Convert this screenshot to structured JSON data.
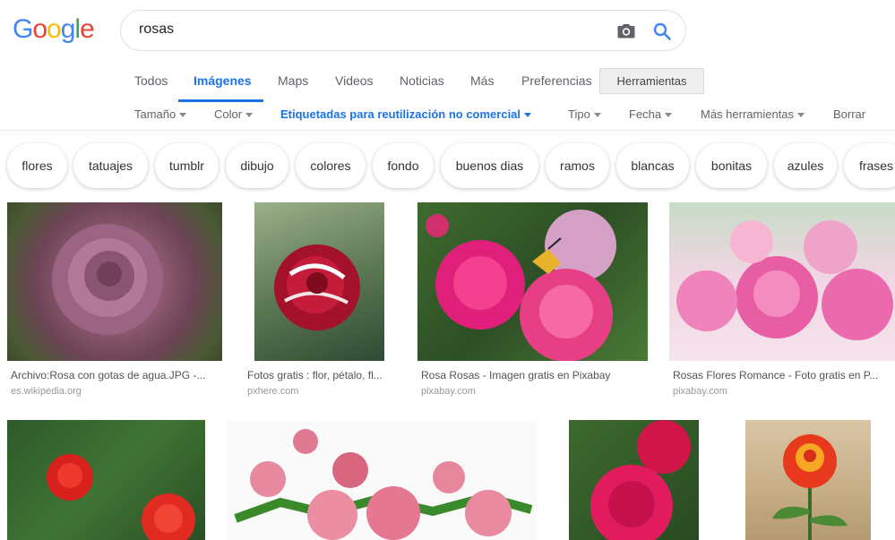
{
  "logo": [
    "G",
    "o",
    "o",
    "g",
    "l",
    "e"
  ],
  "logo_colors": [
    "#4285F4",
    "#EA4335",
    "#FBBC05",
    "#4285F4",
    "#34A853",
    "#EA4335"
  ],
  "search": {
    "value": "rosas"
  },
  "tabs": [
    "Todos",
    "Imágenes",
    "Maps",
    "Videos",
    "Noticias",
    "Más",
    "Preferencias",
    "Herramientas"
  ],
  "filters": [
    "Tamaño",
    "Color",
    "Etiquetadas para reutilización no comercial",
    "Tipo",
    "Fecha",
    "Más herramientas",
    "Borrar"
  ],
  "chips": [
    "flores",
    "tatuajes",
    "tumblr",
    "dibujo",
    "colores",
    "fondo",
    "buenos dias",
    "ramos",
    "blancas",
    "bonitas",
    "azules",
    "frases"
  ],
  "results": [
    {
      "caption": "Archivo:Rosa con gotas de agua.JPG -...",
      "source": "es.wikipedia.org"
    },
    {
      "caption": "Fotos gratis : flor, pétalo, fl...",
      "source": "pxhere.com"
    },
    {
      "caption": "Rosa Rosas - Imagen gratis en Pixabay",
      "source": "pixabay.com"
    },
    {
      "caption": "Rosas Flores Romance - Foto gratis en P...",
      "source": "pixabay.com"
    }
  ],
  "colors": {
    "accent": "#1a73e8",
    "muted": "#5f6368"
  }
}
